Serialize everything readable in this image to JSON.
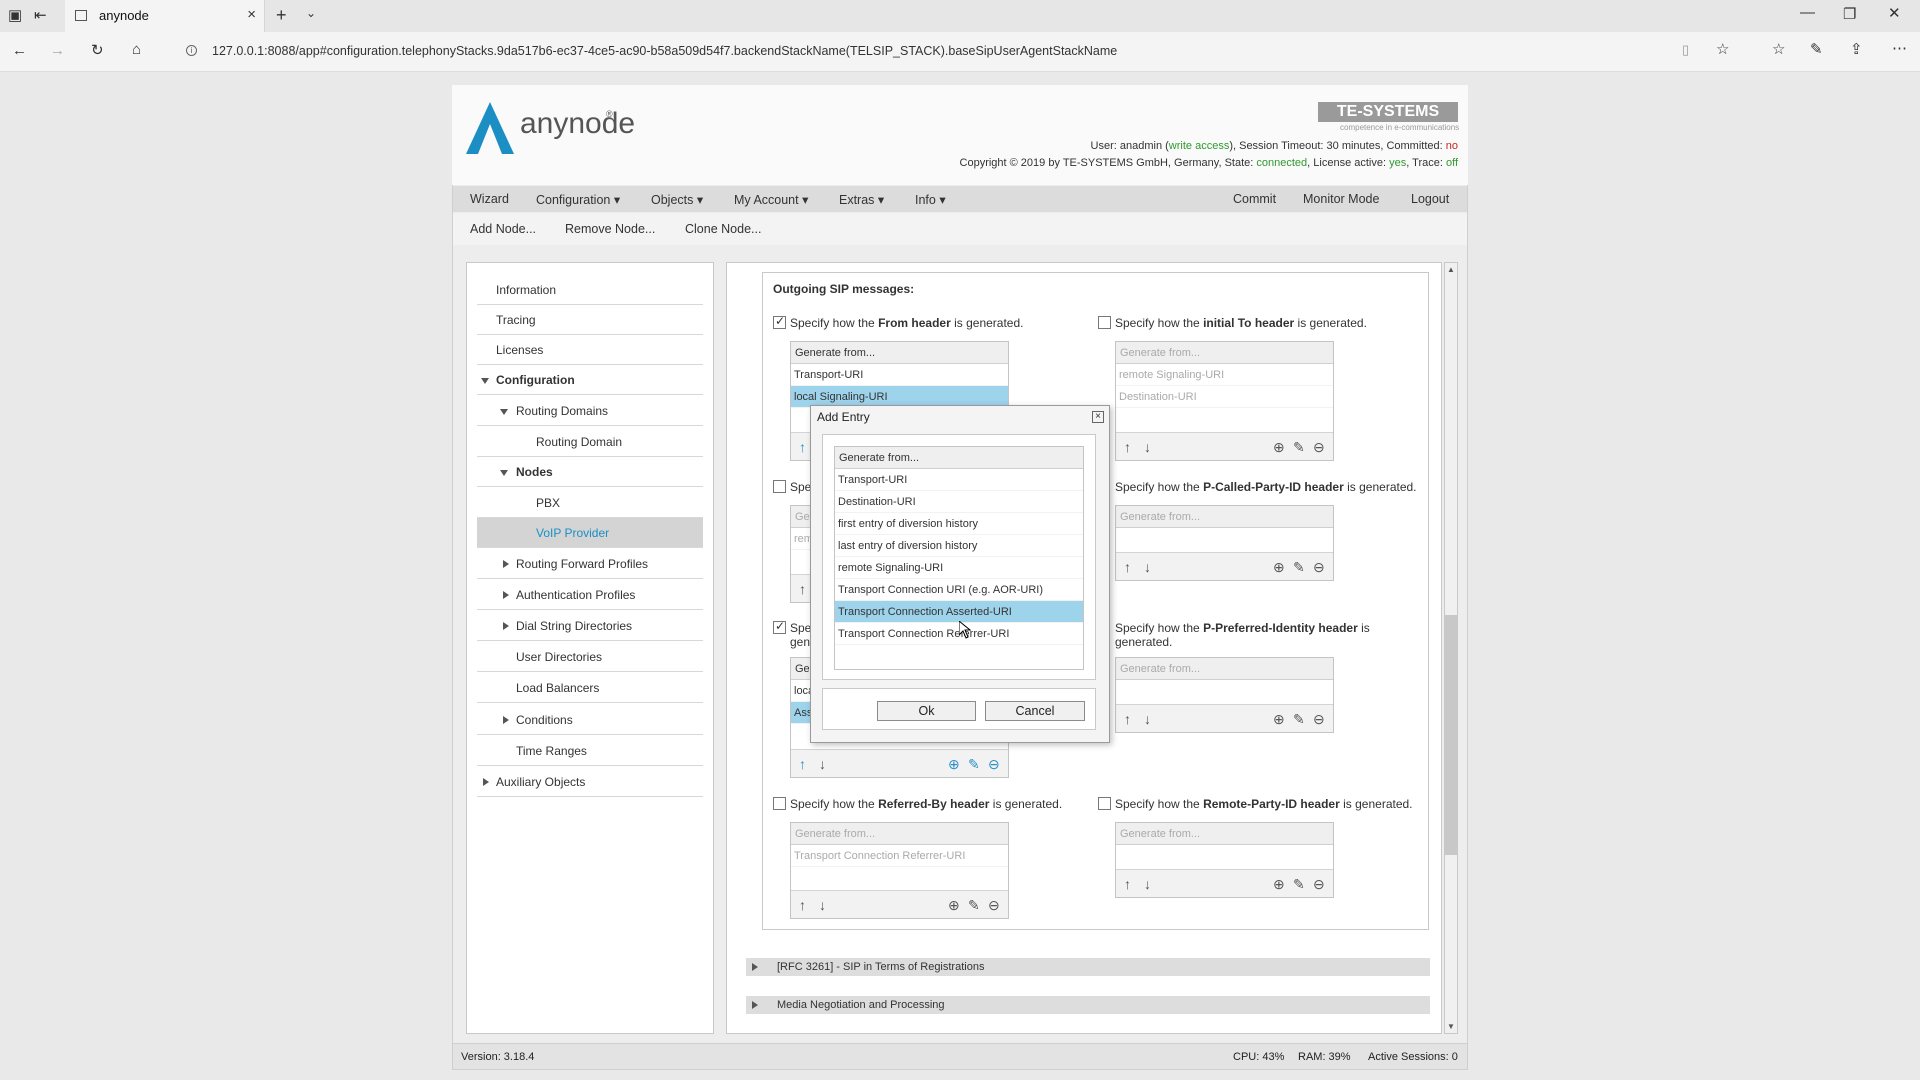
{
  "browser": {
    "tab_title": "anynode",
    "url": "127.0.0.1:8088/app#configuration.telephonyStacks.9da517b6-ec37-4ce5-ac90-b58a509d54f7.backendStackName(TELSIP_STACK).baseSipUserAgentStackName"
  },
  "header": {
    "logo_text": "anynode",
    "brand": "TE-SYSTEMS",
    "brand_tagline": "competence in e-communications",
    "status_line1_user_prefix": "User: anadmin (",
    "status_line1_access": "write access",
    "status_line1_mid": "), Session Timeout: 30 minutes, Committed: ",
    "status_line1_committed": "no",
    "status_line2_prefix": "Copyright © 2019 by TE-SYSTEMS GmbH, Germany, State: ",
    "status_line2_state": "connected",
    "status_line2_mid": ", License active: ",
    "status_line2_license": "yes",
    "status_line2_trace_label": ", Trace: ",
    "status_line2_trace": "off",
    "colors": {
      "ok": "#2e9a2e",
      "no": "#cc2222",
      "accent": "#1b8fc4"
    }
  },
  "menu": {
    "left": [
      "Wizard",
      "Configuration ▾",
      "Objects ▾",
      "My Account ▾",
      "Extras ▾",
      "Info ▾"
    ],
    "right": [
      "Commit",
      "Monitor Mode",
      "Logout"
    ]
  },
  "submenu": [
    "Add Node...",
    "Remove Node...",
    "Clone Node..."
  ],
  "nav": [
    "Information",
    "Tracing",
    "Licenses",
    "Configuration",
    "Routing Domains",
    "Routing Domain",
    "Nodes",
    "PBX",
    "VoIP Provider",
    "Routing Forward Profiles",
    "Authentication Profiles",
    "Dial String Directories",
    "User Directories",
    "Load Balancers",
    "Conditions",
    "Time Ranges",
    "Auxiliary Objects"
  ],
  "content": {
    "heading": "Outgoing SIP messages:",
    "spec_prefix": "Specify how the",
    "spec_suffix": "is generated.",
    "from_header": "From header",
    "to_header": "initial To header",
    "pcalled_header": "P-Called-Party-ID header",
    "ppreferred_header": "P-Preferred-Identity header",
    "ppreferred_suffix": "generated.",
    "referredby_header": "Referred-By header",
    "remoteparty_header": "Remote-Party-ID header",
    "spe_trunc": "Spe",
    "gen_trunc": "gen",
    "generate_from": "Generate from...",
    "from_items": [
      "Transport-URI",
      "local Signaling-URI"
    ],
    "to_items": [
      "remote Signaling-URI",
      "Destination-URI"
    ],
    "pcalled_items": [],
    "left_mid_trunc": [
      "Ge",
      "rem"
    ],
    "left_low_trunc": [
      "Ge",
      "loca",
      "Ass"
    ],
    "referredby_items": [
      "Transport Connection Referrer-URI"
    ],
    "sections": [
      "[RFC 3261] - SIP in Terms of Registrations",
      "Media Negotiation and Processing"
    ]
  },
  "dialog": {
    "title": "Add Entry",
    "close": "×",
    "list_header": "Generate from...",
    "items": [
      "Transport-URI",
      "Destination-URI",
      "first entry of diversion history",
      "last entry of diversion history",
      "remote Signaling-URI",
      "Transport Connection URI (e.g. AOR-URI)",
      "Transport Connection Asserted-URI",
      "Transport Connection Referrer-URI"
    ],
    "selected": "Transport Connection Asserted-URI",
    "ok": "Ok",
    "cancel": "Cancel"
  },
  "statusbar": {
    "version": "Version: 3.18.4",
    "cpu": "CPU: 43%",
    "ram": "RAM: 39%",
    "sessions": "Active Sessions: 0"
  },
  "icons": {
    "up": "up-arrow-icon",
    "down": "down-arrow-icon",
    "add": "plus-circle-icon",
    "edit": "pencil-icon",
    "remove": "minus-circle-icon"
  }
}
